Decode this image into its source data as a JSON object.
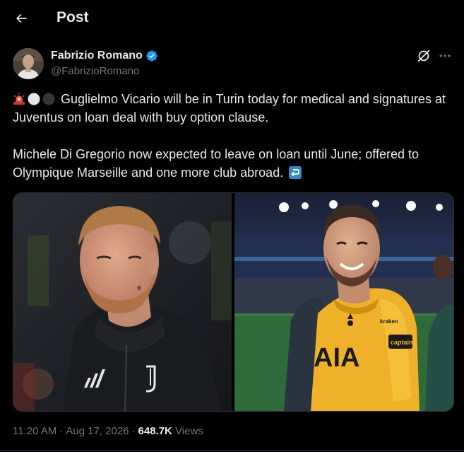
{
  "header": {
    "back_icon": "arrow-left-icon",
    "title": "Post"
  },
  "author": {
    "name": "Fabrizio Romano",
    "handle": "@FabrizioRomano",
    "verified": true,
    "verified_color": "#1d9bf0"
  },
  "actions": {
    "grok_icon": "grok-icon",
    "more_icon": "more-horizontal-icon"
  },
  "tweet": {
    "emojis_line1": [
      "siren-emoji",
      "white-circle-emoji",
      "black-circle-emoji"
    ],
    "line1": "Guglielmo Vicario will be in Turin today for medical and signatures at Juventus on loan deal with buy option clause.",
    "line2": "Michele Di Gregorio now expected to leave on loan until June; offered to Olympique Marseille and one more club abroad.",
    "end_emoji": "return-arrow-emoji"
  },
  "media": [
    {
      "name": "photo-di-gregorio-juventus",
      "kit": "juventus-black-jacket"
    },
    {
      "name": "photo-vicario-tottenham",
      "kit": "tottenham-yellow-goalkeeper",
      "armband": "captain",
      "sponsor": "kraken"
    }
  ],
  "meta": {
    "time": "11:20 AM",
    "date": "Aug 17, 2026",
    "views_count": "648.7K",
    "views_label": "Views"
  },
  "colors": {
    "background": "#000000",
    "text": "#e7e9ea",
    "secondary": "#71767b",
    "border": "#2f3336",
    "accent": "#1d9bf0"
  }
}
